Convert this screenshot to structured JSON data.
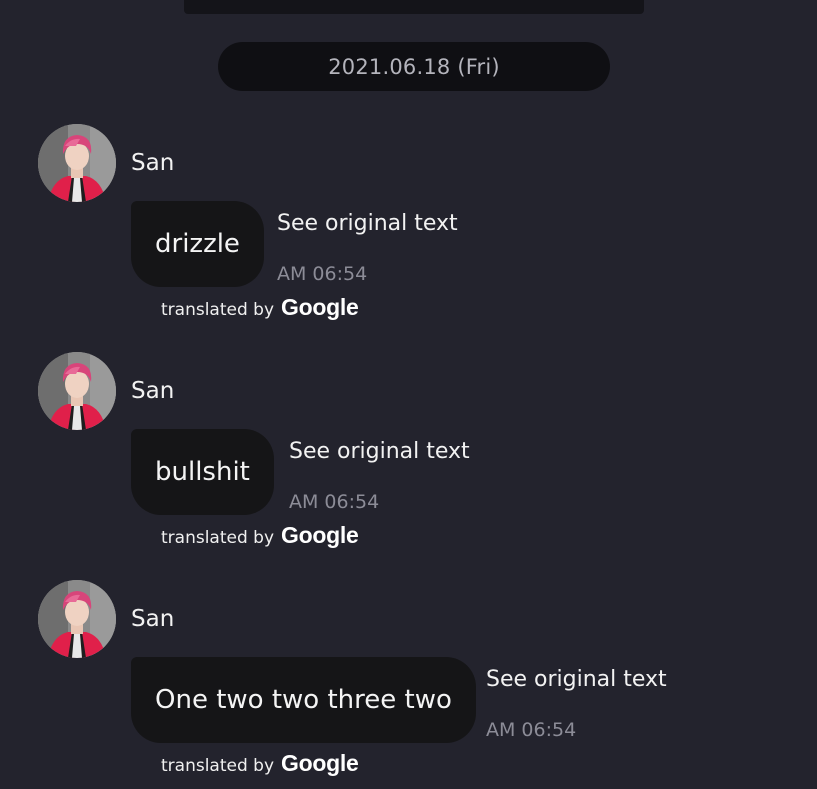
{
  "date_separator": "2021.06.18 (Fri)",
  "messages": [
    {
      "sender": "San",
      "text": "drizzle",
      "see_original": "See original text",
      "time": "AM 06:54",
      "translated_prefix": "translated by",
      "translated_brand": "Google"
    },
    {
      "sender": "San",
      "text": "bullshit",
      "see_original": "See original text",
      "time": "AM 06:54",
      "translated_prefix": "translated by",
      "translated_brand": "Google"
    },
    {
      "sender": "San",
      "text": "One two two three two",
      "see_original": "See original text",
      "time": "AM 06:54",
      "translated_prefix": "translated by",
      "translated_brand": "Google"
    }
  ],
  "colors": {
    "background": "#23232d",
    "bubble": "#151517",
    "date_pill": "#0f0f13",
    "timestamp": "#8c8c97",
    "avatar_hair": "#d8457a",
    "avatar_jacket": "#e0204a"
  }
}
